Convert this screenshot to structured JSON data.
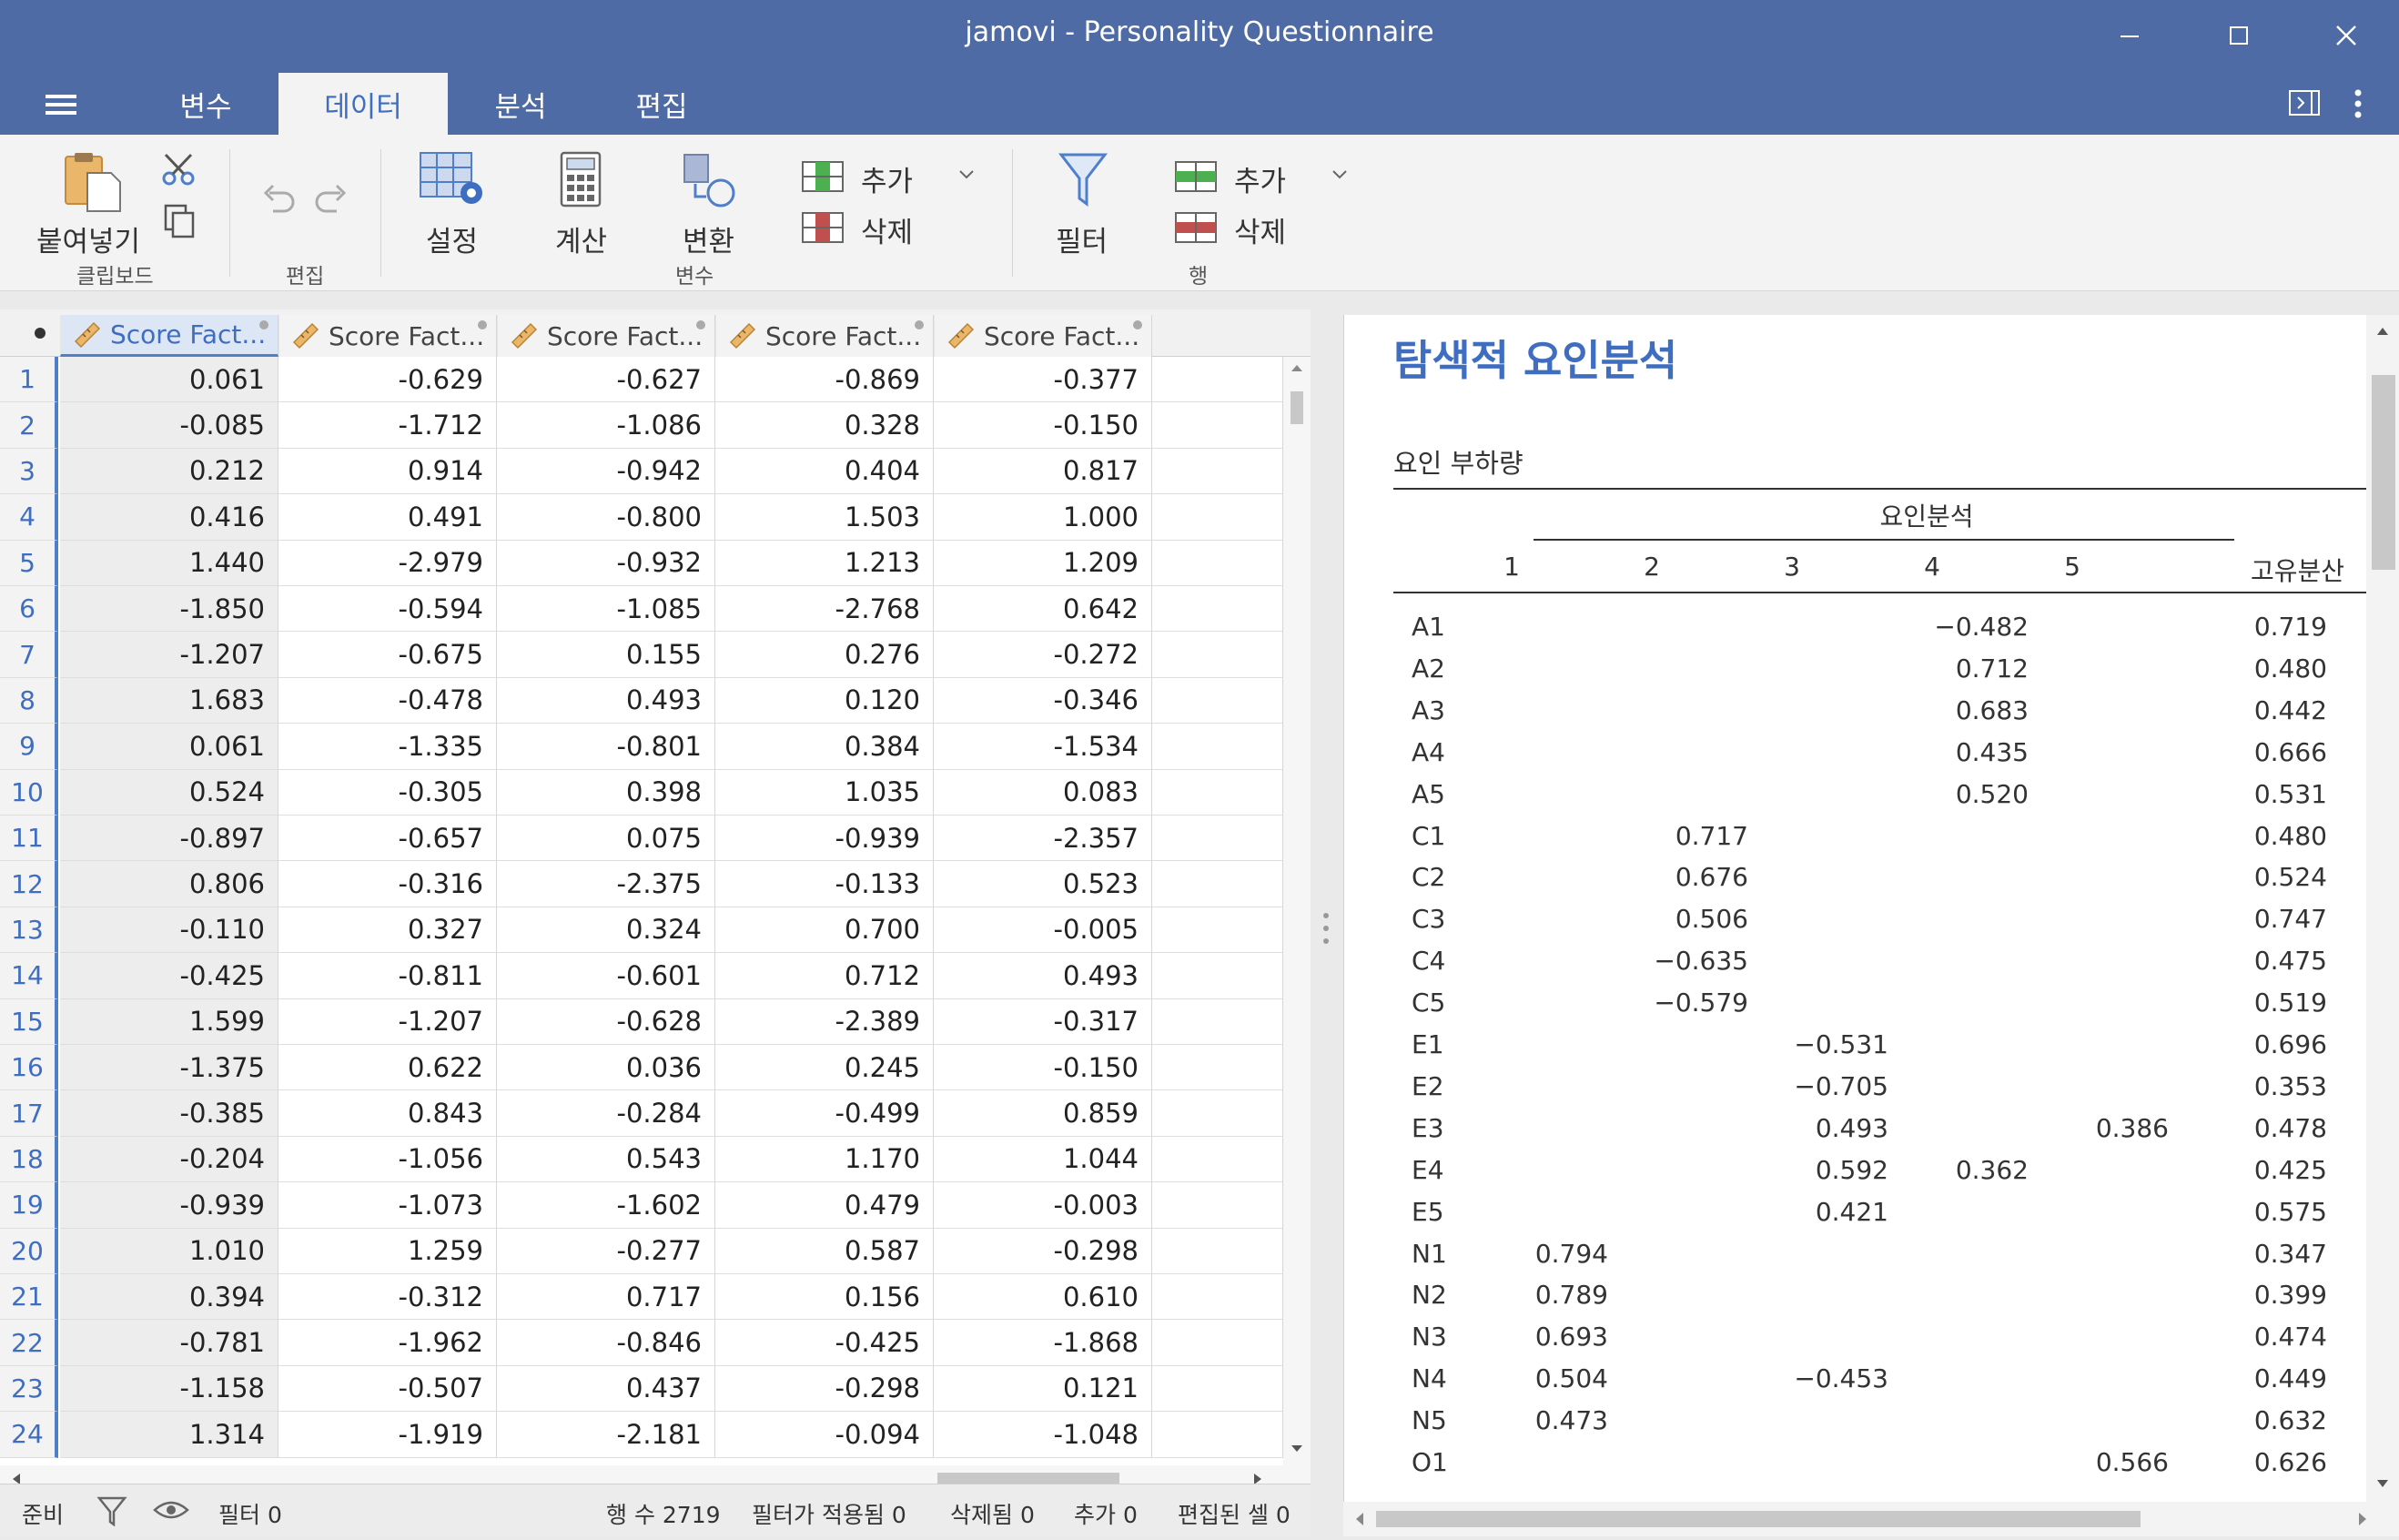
{
  "window": {
    "title": "jamovi - Personality Questionnaire"
  },
  "tabs": [
    "변수",
    "데이터",
    "분석",
    "편집"
  ],
  "ribbon": {
    "paste": "붙여넣기",
    "clipboard_group": "클립보드",
    "edit_group": "편집",
    "setup": "설정",
    "compute": "계산",
    "transform": "변환",
    "add_var": "추가",
    "delete_var": "삭제",
    "variables_group": "변수",
    "filter": "필터",
    "add_row": "추가",
    "delete_row": "삭제",
    "rows_group": "행"
  },
  "grid": {
    "columns": [
      "Score Fact...",
      "Score Fact...",
      "Score Fact...",
      "Score Fact...",
      "Score Fact..."
    ],
    "rows": [
      [
        "1",
        "0.061",
        "-0.629",
        "-0.627",
        "-0.869",
        "-0.377"
      ],
      [
        "2",
        "-0.085",
        "-1.712",
        "-1.086",
        "0.328",
        "-0.150"
      ],
      [
        "3",
        "0.212",
        "0.914",
        "-0.942",
        "0.404",
        "0.817"
      ],
      [
        "4",
        "0.416",
        "0.491",
        "-0.800",
        "1.503",
        "1.000"
      ],
      [
        "5",
        "1.440",
        "-2.979",
        "-0.932",
        "1.213",
        "1.209"
      ],
      [
        "6",
        "-1.850",
        "-0.594",
        "-1.085",
        "-2.768",
        "0.642"
      ],
      [
        "7",
        "-1.207",
        "-0.675",
        "0.155",
        "0.276",
        "-0.272"
      ],
      [
        "8",
        "1.683",
        "-0.478",
        "0.493",
        "0.120",
        "-0.346"
      ],
      [
        "9",
        "0.061",
        "-1.335",
        "-0.801",
        "0.384",
        "-1.534"
      ],
      [
        "10",
        "0.524",
        "-0.305",
        "0.398",
        "1.035",
        "0.083"
      ],
      [
        "11",
        "-0.897",
        "-0.657",
        "0.075",
        "-0.939",
        "-2.357"
      ],
      [
        "12",
        "0.806",
        "-0.316",
        "-2.375",
        "-0.133",
        "0.523"
      ],
      [
        "13",
        "-0.110",
        "0.327",
        "0.324",
        "0.700",
        "-0.005"
      ],
      [
        "14",
        "-0.425",
        "-0.811",
        "-0.601",
        "0.712",
        "0.493"
      ],
      [
        "15",
        "1.599",
        "-1.207",
        "-0.628",
        "-2.389",
        "-0.317"
      ],
      [
        "16",
        "-1.375",
        "0.622",
        "0.036",
        "0.245",
        "-0.150"
      ],
      [
        "17",
        "-0.385",
        "0.843",
        "-0.284",
        "-0.499",
        "0.859"
      ],
      [
        "18",
        "-0.204",
        "-1.056",
        "0.543",
        "1.170",
        "1.044"
      ],
      [
        "19",
        "-0.939",
        "-1.073",
        "-1.602",
        "0.479",
        "-0.003"
      ],
      [
        "20",
        "1.010",
        "1.259",
        "-0.277",
        "0.587",
        "-0.298"
      ],
      [
        "21",
        "0.394",
        "-0.312",
        "0.717",
        "0.156",
        "0.610"
      ],
      [
        "22",
        "-0.781",
        "-1.962",
        "-0.846",
        "-0.425",
        "-1.868"
      ],
      [
        "23",
        "-1.158",
        "-0.507",
        "0.437",
        "-0.298",
        "0.121"
      ],
      [
        "24",
        "1.314",
        "-1.919",
        "-2.181",
        "-0.094",
        "-1.048"
      ]
    ]
  },
  "status": {
    "ready": "준비",
    "filter": "필터 0",
    "row_count": "행 수 2719",
    "filtered": "필터가 적용됨 0",
    "deleted": "삭제됨 0",
    "added": "추가 0",
    "edited": "편집된 셀 0"
  },
  "results": {
    "title": "탐색적 요인분석",
    "subtitle": "요인 부하량",
    "factor_header": "요인분석",
    "factor_cols": [
      "1",
      "2",
      "3",
      "4",
      "5"
    ],
    "uniqueness_header": "고유분산",
    "loadings": [
      [
        "A1",
        "",
        "",
        "",
        "−0.482",
        "",
        "0.719"
      ],
      [
        "A2",
        "",
        "",
        "",
        "0.712",
        "",
        "0.480"
      ],
      [
        "A3",
        "",
        "",
        "",
        "0.683",
        "",
        "0.442"
      ],
      [
        "A4",
        "",
        "",
        "",
        "0.435",
        "",
        "0.666"
      ],
      [
        "A5",
        "",
        "",
        "",
        "0.520",
        "",
        "0.531"
      ],
      [
        "C1",
        "",
        "0.717",
        "",
        "",
        "",
        "0.480"
      ],
      [
        "C2",
        "",
        "0.676",
        "",
        "",
        "",
        "0.524"
      ],
      [
        "C3",
        "",
        "0.506",
        "",
        "",
        "",
        "0.747"
      ],
      [
        "C4",
        "",
        "−0.635",
        "",
        "",
        "",
        "0.475"
      ],
      [
        "C5",
        "",
        "−0.579",
        "",
        "",
        "",
        "0.519"
      ],
      [
        "E1",
        "",
        "",
        "−0.531",
        "",
        "",
        "0.696"
      ],
      [
        "E2",
        "",
        "",
        "−0.705",
        "",
        "",
        "0.353"
      ],
      [
        "E3",
        "",
        "",
        "0.493",
        "",
        "0.386",
        "0.478"
      ],
      [
        "E4",
        "",
        "",
        "0.592",
        "0.362",
        "",
        "0.425"
      ],
      [
        "E5",
        "",
        "",
        "0.421",
        "",
        "",
        "0.575"
      ],
      [
        "N1",
        "0.794",
        "",
        "",
        "",
        "",
        "0.347"
      ],
      [
        "N2",
        "0.789",
        "",
        "",
        "",
        "",
        "0.399"
      ],
      [
        "N3",
        "0.693",
        "",
        "",
        "",
        "",
        "0.474"
      ],
      [
        "N4",
        "0.504",
        "",
        "−0.453",
        "",
        "",
        "0.449"
      ],
      [
        "N5",
        "0.473",
        "",
        "",
        "",
        "",
        "0.632"
      ],
      [
        "O1",
        "",
        "",
        "",
        "",
        "0.566",
        "0.626"
      ]
    ]
  },
  "colors": {
    "title_bar": "#4f6ba5",
    "accent": "#3f6ec0",
    "ribbon_bg": "#f3f3f3"
  }
}
